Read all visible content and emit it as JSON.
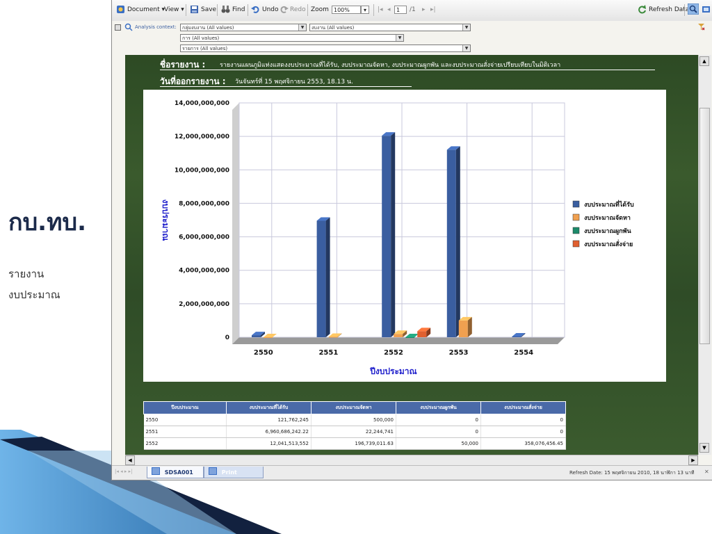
{
  "slide": {
    "title": "กบ.ทบ.",
    "sub1": "รายงาน",
    "sub2": "งบประมาณ"
  },
  "toolbar": {
    "document": "Document ▾",
    "view": "View ▾",
    "save": "Save",
    "find": "Find",
    "undo": "Undo",
    "redo": "Redo",
    "zoom_label": "Zoom",
    "zoom_value": "100%",
    "page_value": "1",
    "page_of": "/1",
    "refresh": "Refresh Data"
  },
  "context": {
    "label": "Analysis context:",
    "filter1": "กลุ่มงบงาน (All values)",
    "filter2": "งบงาน (All values)",
    "filter3": "การ (All values)",
    "filter4": "รายการ (All values)"
  },
  "report": {
    "name_label": "ชื่อรายงาน :",
    "name_value": "รายงานแผนภูมิแท่งแสดงงบประมาณที่ได้รับ, งบประมาณจัดหา, งบประมาณผูกพัน และงบประมาณสั่งจ่ายเปรียบเทียบในมิติเวลา",
    "date_label": "วันที่ออกรายงาน :",
    "date_value": "วันจันทร์ที่ 15 พฤศจิกายน 2553, 18.13 น."
  },
  "chart_data": {
    "type": "bar",
    "categories": [
      "2550",
      "2551",
      "2552",
      "2553",
      "2554"
    ],
    "series": [
      {
        "name": "งบประมาณที่ได้รับ",
        "color": "#3a5ea0",
        "values": [
          121762245,
          6960686242.22,
          12041513552,
          11200000000,
          0
        ]
      },
      {
        "name": "งบประมาณจัดหา",
        "color": "#f0a050",
        "values": [
          500000,
          22244741,
          196739011.63,
          1000000000,
          0
        ]
      },
      {
        "name": "งบประมาณผูกพัน",
        "color": "#1c8a6a",
        "values": [
          0,
          0,
          50000,
          0,
          0
        ]
      },
      {
        "name": "งบประมาณสั่งจ่าย",
        "color": "#e06030",
        "values": [
          0,
          0,
          358076456.45,
          0,
          0
        ]
      }
    ],
    "xlabel": "ปีงบประมาณ",
    "ylabel": "งบประมาณ",
    "ylim": [
      0,
      14000000000
    ],
    "yticks": [
      "0",
      "2,000,000,000",
      "4,000,000,000",
      "6,000,000,000",
      "8,000,000,000",
      "10,000,000,000",
      "12,000,000,000",
      "14,000,000,000"
    ],
    "grid": true,
    "legend": "right"
  },
  "table": {
    "headers": [
      "ปีงบประมาณ",
      "งบประมาณที่ได้รับ",
      "งบประมาณจัดหา",
      "งบประมาณผูกพัน",
      "งบประมาณสั่งจ่าย"
    ],
    "rows": [
      [
        "2550",
        "121,762,245",
        "500,000",
        "0",
        "0"
      ],
      [
        "2551",
        "6,960,686,242.22",
        "22,244,741",
        "0",
        "0"
      ],
      [
        "2552",
        "12,041,513,552",
        "196,739,011.63",
        "50,000",
        "358,076,456.45"
      ]
    ]
  },
  "status": {
    "tab1": "SDSA001",
    "tab2": "Print",
    "refresh_date": "Refresh Date: 15 พฤศจิกายน 2010, 18 นาฬิกา 13 นาที"
  }
}
